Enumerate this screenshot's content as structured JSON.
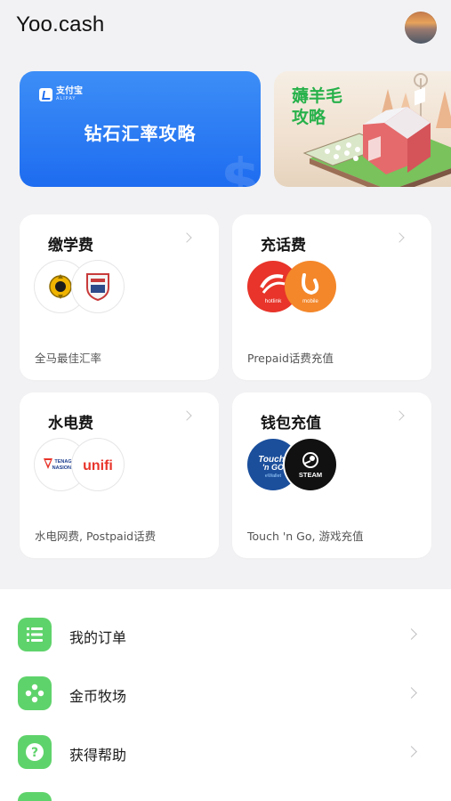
{
  "header": {
    "app_title": "Yoo.cash"
  },
  "banners": {
    "blue": {
      "logo_cn": "支付宝",
      "logo_en": "ALIPAY",
      "title": "钻石汇率攻略"
    },
    "farm": {
      "title": "薅羊毛攻略"
    }
  },
  "cards": [
    {
      "title": "缴学费",
      "desc": "全马最佳汇率"
    },
    {
      "title": "充话费",
      "desc": "Prepaid话费充值",
      "logos": [
        "hotlink",
        "mobile"
      ]
    },
    {
      "title": "水电费",
      "desc": "水电网费, Postpaid话费",
      "logos": [
        "TENAGA NASIONAL",
        "unifi"
      ]
    },
    {
      "title": "钱包充值",
      "desc": "Touch 'n Go, 游戏充值",
      "logos": [
        "Touch 'n Go eWallet",
        "STEAM"
      ]
    }
  ],
  "menu": [
    {
      "label": "我的订单",
      "icon": "list-icon"
    },
    {
      "label": "金币牧场",
      "icon": "gamepad-icon"
    },
    {
      "label": "获得帮助",
      "icon": "question-icon"
    }
  ],
  "colors": {
    "accent_green": "#5fd36b",
    "banner_blue": "#1e6cf0",
    "background": "#f2f2f4"
  }
}
